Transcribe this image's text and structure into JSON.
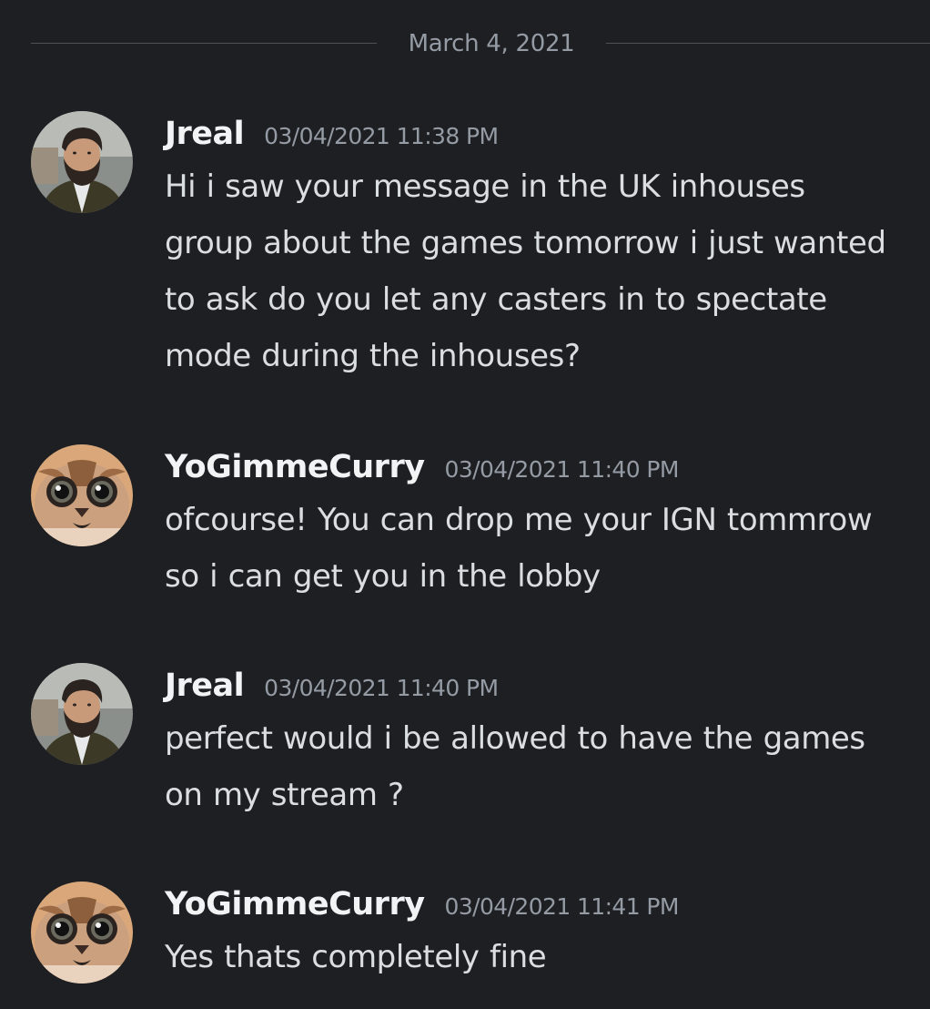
{
  "date_divider": "March 4, 2021",
  "messages": [
    {
      "username": "Jreal",
      "timestamp": "03/04/2021 11:38 PM",
      "text": "Hi i saw your message in the UK inhouses group about the games tomorrow i just wanted to ask do you let any casters in to spectate mode during the inhouses?",
      "avatar": "man-avatar"
    },
    {
      "username": "YoGimmeCurry",
      "timestamp": "03/04/2021 11:40 PM",
      "text": "ofcourse! You can drop me your IGN tommrow so i can get you in the lobby",
      "avatar": "cat-avatar"
    },
    {
      "username": "Jreal",
      "timestamp": "03/04/2021 11:40 PM",
      "text": "perfect would i be allowed to have the games on my stream ?",
      "avatar": "man-avatar"
    },
    {
      "username": "YoGimmeCurry",
      "timestamp": "03/04/2021 11:41 PM",
      "text": "Yes thats completely fine",
      "avatar": "cat-avatar"
    }
  ],
  "colors": {
    "background": "#1e1f22",
    "username": "#f2f3f5",
    "timestamp": "#949ba4",
    "message_text": "#dbdee1",
    "divider": "#4e5058"
  }
}
